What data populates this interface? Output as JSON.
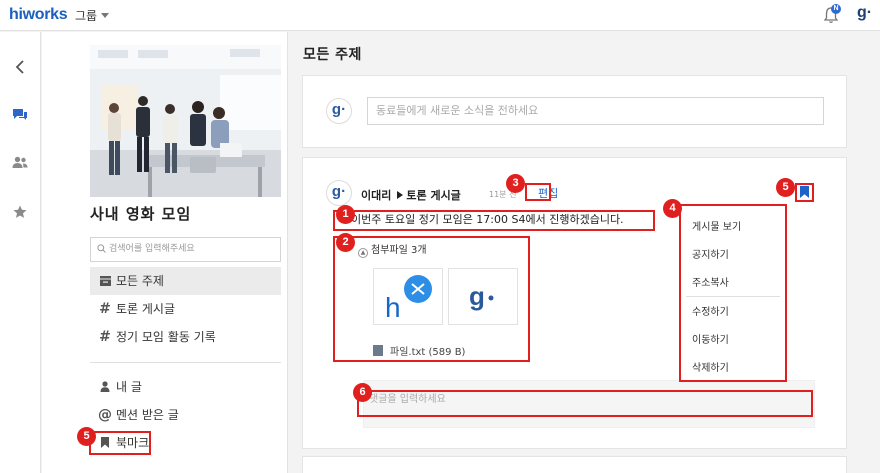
{
  "topbar": {
    "logo": "hiworks",
    "group_menu": "그룹",
    "bell_badge": "N",
    "user_initial": "g·"
  },
  "nav_rail": {
    "icons": [
      "chevron-left-icon",
      "chat-icon",
      "users-icon",
      "star-icon"
    ]
  },
  "sidebar": {
    "group_name": "사내 영화 모임",
    "search_placeholder": "검색어를 입력해주세요",
    "menu": [
      {
        "icon": "list-icon",
        "label": "모든 주제",
        "active": true
      },
      {
        "icon": "hash-icon",
        "label": "토론 게시글"
      },
      {
        "icon": "hash-icon",
        "label": "정기 모임 활동 기록"
      }
    ],
    "personal": [
      {
        "icon": "user-icon",
        "label": "내 글"
      },
      {
        "icon": "at-icon",
        "label": "멘션 받은 글"
      },
      {
        "icon": "bookmark-icon",
        "label": "북마크"
      }
    ]
  },
  "main": {
    "title": "모든 주제",
    "compose_placeholder": "동료들에게 새로운 소식을 전하세요",
    "post": {
      "avatar": "g·",
      "author": "이대리",
      "board": "토론 게시글",
      "time": "11분 전",
      "edit": "편집",
      "text": "이번주 토요일 정기 모임은 17:00 S4에서 진행하겠습니다.",
      "attach_header": "첨부파일 3개",
      "file_name": "파일.txt",
      "file_size": "(589 B)",
      "comment_placeholder": "댓글을 입력하세요"
    },
    "dropdown": [
      "게시물 보기",
      "공지하기",
      "주소복사",
      "수정하기",
      "이동하기",
      "삭제하기"
    ]
  },
  "annotations": {
    "badges": [
      "1",
      "2",
      "3",
      "4",
      "5",
      "5",
      "6"
    ]
  },
  "colors": {
    "brand": "#1b5fbf",
    "highlight": "#e0201f",
    "link": "#1e62c7"
  }
}
